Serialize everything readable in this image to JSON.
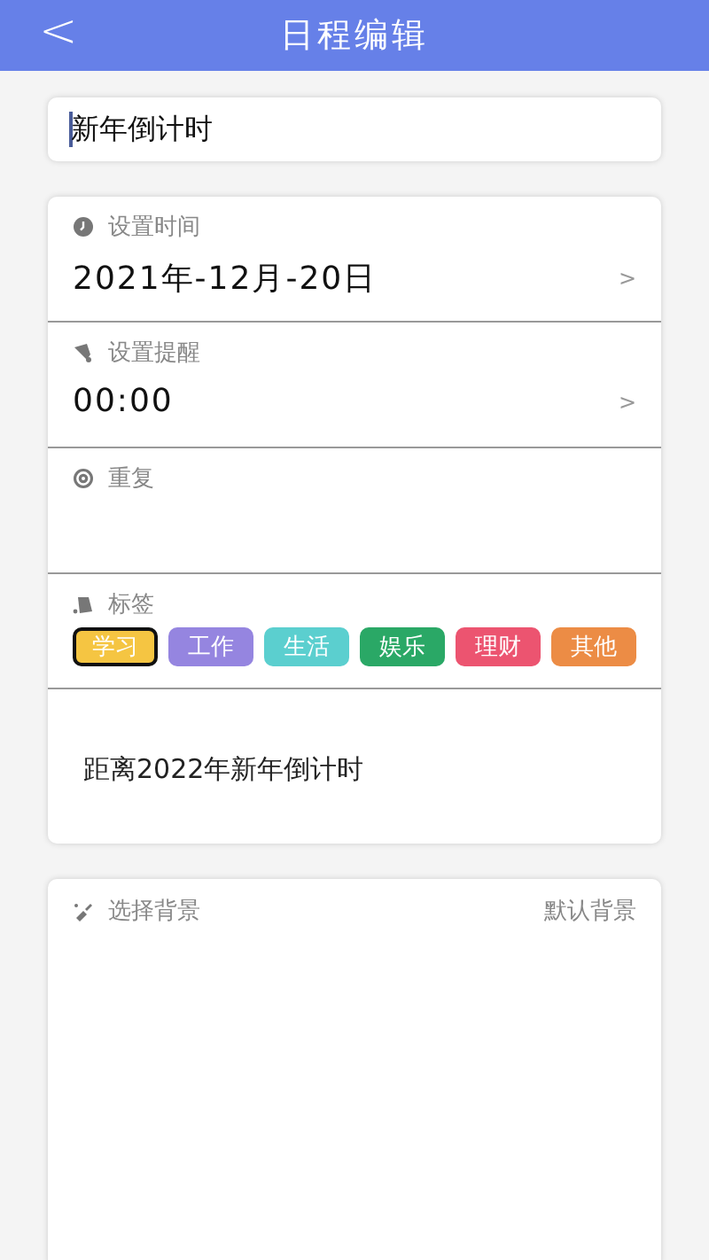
{
  "header": {
    "back": "<",
    "title": "日程编辑"
  },
  "title_field": {
    "value": "新年倒计时"
  },
  "time": {
    "label": "设置时间",
    "value": "2021年-12月-20日",
    "chevron": ">"
  },
  "reminder": {
    "label": "设置提醒",
    "value": "00:00",
    "chevron": ">"
  },
  "repeat": {
    "label": "重复"
  },
  "tags": {
    "label": "标签",
    "items": [
      {
        "label": "学习",
        "color": "#f5c542",
        "selected": true
      },
      {
        "label": "工作",
        "color": "#9585e0",
        "selected": false
      },
      {
        "label": "生活",
        "color": "#5bcfcf",
        "selected": false
      },
      {
        "label": "娱乐",
        "color": "#2aa866",
        "selected": false
      },
      {
        "label": "理财",
        "color": "#ec5470",
        "selected": false
      },
      {
        "label": "其他",
        "color": "#ec8c45",
        "selected": false
      }
    ]
  },
  "note": "距离2022年新年倒计时",
  "background": {
    "label": "选择背景",
    "value": "默认背景"
  }
}
